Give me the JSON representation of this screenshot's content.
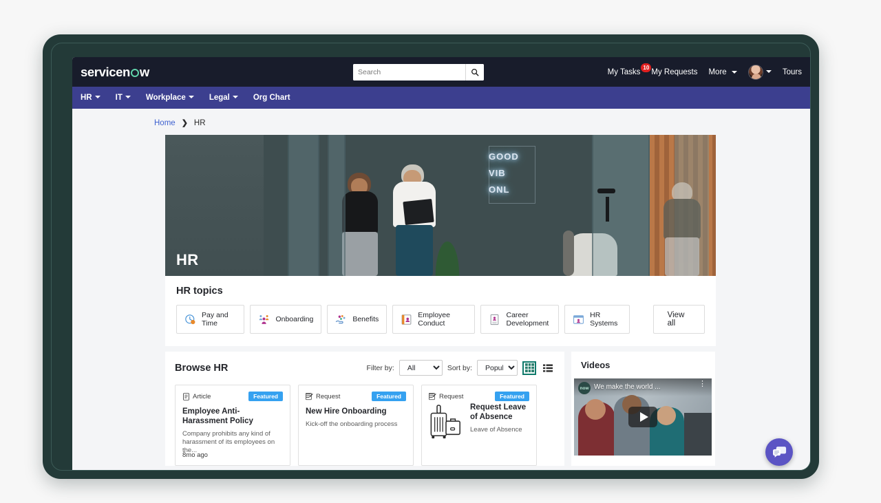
{
  "header": {
    "logo_text": "servicenow",
    "search": {
      "placeholder": "Search",
      "value": "",
      "icon": "search-icon"
    },
    "links": [
      {
        "label": "My Tasks",
        "badge": "10"
      },
      {
        "label": "My Requests",
        "badge": ""
      },
      {
        "label": "More",
        "badge": ""
      }
    ],
    "tours_label": "Tours",
    "avatar_alt": "user-avatar"
  },
  "nav": {
    "items": [
      {
        "label": "HR",
        "has_caret": true
      },
      {
        "label": "IT",
        "has_caret": true
      },
      {
        "label": "Workplace",
        "has_caret": true
      },
      {
        "label": "Legal",
        "has_caret": true
      },
      {
        "label": "Org Chart",
        "has_caret": false
      }
    ]
  },
  "breadcrumb": {
    "home": "Home",
    "separator": "❯",
    "current": "HR"
  },
  "hero": {
    "title": "HR",
    "neon_text_1": "GOOD",
    "neon_text_2": "VIB",
    "neon_text_3": "ONL"
  },
  "topics": {
    "title": "HR topics",
    "items": [
      {
        "label": "Pay and Time",
        "icon": "clock-icon"
      },
      {
        "label": "Onboarding",
        "icon": "people-icon"
      },
      {
        "label": "Benefits",
        "icon": "benefits-hand-icon"
      },
      {
        "label": "Employee Conduct",
        "icon": "book-icon"
      },
      {
        "label": "Career Development",
        "icon": "certificate-icon"
      },
      {
        "label": "HR Systems",
        "icon": "window-icon"
      }
    ],
    "view_all_label": "View all"
  },
  "browse": {
    "title": "Browse HR",
    "filter_label": "Filter by:",
    "filter_value": "All",
    "filter_options": [
      "All"
    ],
    "sort_label": "Sort by:",
    "sort_value": "Popular",
    "sort_options": [
      "Popular"
    ],
    "grid_view_icon": "grid-view-icon",
    "list_view_icon": "list-view-icon",
    "active_view": "grid",
    "cards": [
      {
        "kind": "Article",
        "kind_icon": "article-icon",
        "badge": "Featured",
        "title": "Employee Anti-Harassment Policy",
        "description": "Company prohibits any kind of harassment of its employees on the...",
        "age": "8mo ago",
        "art": ""
      },
      {
        "kind": "Request",
        "kind_icon": "request-icon",
        "badge": "Featured",
        "title": "New Hire Onboarding",
        "description": "Kick-off the onboarding process",
        "age": "",
        "art": ""
      },
      {
        "kind": "Request",
        "kind_icon": "request-icon",
        "badge": "Featured",
        "title": "Request Leave of Absence",
        "description": "Leave of Absence",
        "age": "",
        "art": "luggage-icon"
      }
    ]
  },
  "videos": {
    "title": "Videos",
    "thumb": {
      "channel_badge": "now",
      "title": "We make the world ...",
      "menu_icon": "kebab-menu-icon",
      "play_icon": "play-icon"
    }
  },
  "chat": {
    "icon": "chat-bubble-icon"
  },
  "colors": {
    "topbar": "#181c2b",
    "navbar": "#3c3f8f",
    "accent_link": "#3f62d0",
    "badge_red": "#e02020",
    "featured_blue": "#35a1f0",
    "toggle_teal": "#0f7a6b",
    "chat_purple": "#5b54c4",
    "bezel": "#233a38",
    "page_bg": "#f4f5f7"
  }
}
